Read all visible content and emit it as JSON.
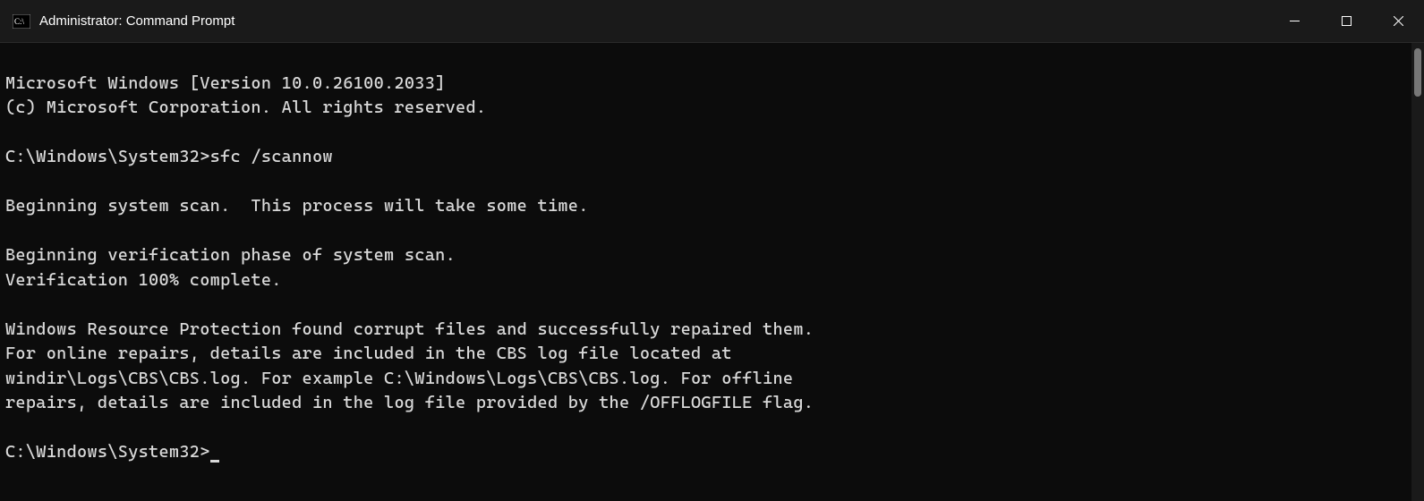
{
  "window": {
    "title": "Administrator: Command Prompt"
  },
  "terminal": {
    "header1": "Microsoft Windows [Version 10.0.26100.2033]",
    "header2": "(c) Microsoft Corporation. All rights reserved.",
    "prompt1_path": "C:\\Windows\\System32>",
    "prompt1_cmd": "sfc /scannow",
    "line1": "Beginning system scan.  This process will take some time.",
    "line2": "Beginning verification phase of system scan.",
    "line3": "Verification 100% complete.",
    "line4": "Windows Resource Protection found corrupt files and successfully repaired them.",
    "line5": "For online repairs, details are included in the CBS log file located at",
    "line6": "windir\\Logs\\CBS\\CBS.log. For example C:\\Windows\\Logs\\CBS\\CBS.log. For offline",
    "line7": "repairs, details are included in the log file provided by the /OFFLOGFILE flag.",
    "prompt2_path": "C:\\Windows\\System32>"
  }
}
